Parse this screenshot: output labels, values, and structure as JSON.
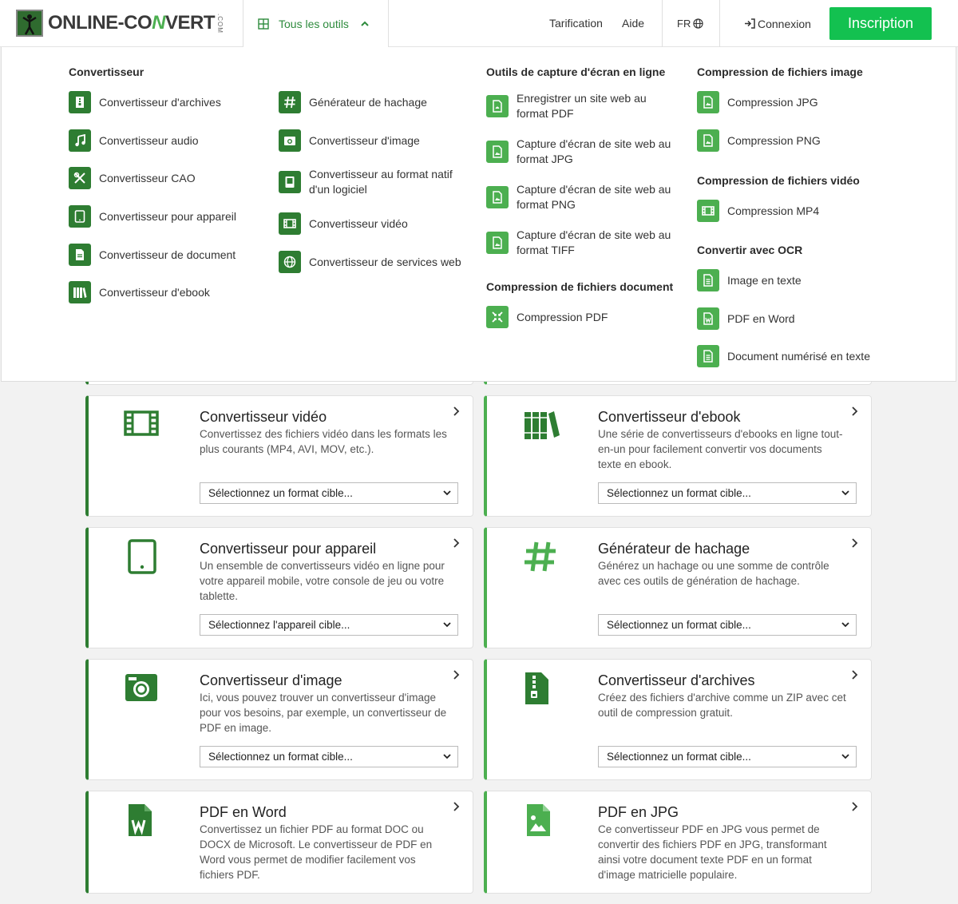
{
  "header": {
    "logo_prefix": "ONLINE-CO",
    "logo_accent": "N",
    "logo_suffix": "VERT",
    "logo_com": ".COM",
    "tools_label": "Tous les outils",
    "pricing": "Tarification",
    "help": "Aide",
    "lang": "FR",
    "login": "Connexion",
    "signup": "Inscription"
  },
  "dropdown": {
    "col1_title": "Convertisseur",
    "col1": [
      {
        "label": "Convertisseur d'archives",
        "icon": "archive-icon"
      },
      {
        "label": "Convertisseur audio",
        "icon": "music-note-icon"
      },
      {
        "label": "Convertisseur CAO",
        "icon": "cad-tools-icon"
      },
      {
        "label": "Convertisseur pour appareil",
        "icon": "tablet-icon"
      },
      {
        "label": "Convertisseur de document",
        "icon": "document-icon"
      },
      {
        "label": "Convertisseur d'ebook",
        "icon": "books-icon"
      }
    ],
    "col2": [
      {
        "label": "Générateur de hachage",
        "icon": "hash-icon"
      },
      {
        "label": "Convertisseur d'image",
        "icon": "camera-icon"
      },
      {
        "label": "Convertisseur au format natif d'un logiciel",
        "icon": "software-icon"
      },
      {
        "label": "Convertisseur vidéo",
        "icon": "film-icon"
      },
      {
        "label": "Convertisseur de services web",
        "icon": "globe-icon"
      }
    ],
    "col3_title": "Outils de capture d'écran en ligne",
    "col3": [
      {
        "label": "Enregistrer un site web au format PDF",
        "icon": "pdf-file-icon"
      },
      {
        "label": "Capture d'écran de site web au format JPG",
        "icon": "image-file-icon"
      },
      {
        "label": "Capture d'écran de site web au format PNG",
        "icon": "image-file-icon"
      },
      {
        "label": "Capture d'écran de site web au format TIFF",
        "icon": "image-file-icon"
      }
    ],
    "col3b_title": "Compression de fichiers document",
    "col3b": [
      {
        "label": "Compression PDF",
        "icon": "compress-icon"
      }
    ],
    "col4_title": "Compression de fichiers image",
    "col4": [
      {
        "label": "Compression JPG",
        "icon": "image-file-icon"
      },
      {
        "label": "Compression PNG",
        "icon": "image-file-icon"
      }
    ],
    "col4b_title": "Compression de fichiers vidéo",
    "col4b": [
      {
        "label": "Compression MP4",
        "icon": "film-icon"
      }
    ],
    "col4c_title": "Convertir avec OCR",
    "col4c": [
      {
        "label": "Image en texte",
        "icon": "text-file-icon"
      },
      {
        "label": "PDF en Word",
        "icon": "word-file-icon"
      },
      {
        "label": "Document numérisé en texte",
        "icon": "text-file-icon"
      }
    ]
  },
  "cards": [
    {
      "title": "Convertisseur vidéo",
      "desc": "Convertissez des fichiers vidéo dans les formats les plus courants (MP4, AVI, MOV, etc.).",
      "select": "Sélectionnez un format cible...",
      "icon": "film-icon"
    },
    {
      "title": "Convertisseur d'ebook",
      "desc": "Une série de convertisseurs d'ebooks en ligne tout-en-un pour facilement convertir vos documents texte en ebook.",
      "select": "Sélectionnez un format cible...",
      "icon": "books-icon"
    },
    {
      "title": "Convertisseur pour appareil",
      "desc": "Un ensemble de convertisseurs vidéo en ligne pour votre appareil mobile, votre console de jeu ou votre tablette.",
      "select": "Sélectionnez l'appareil cible...",
      "icon": "tablet-icon"
    },
    {
      "title": "Générateur de hachage",
      "desc": "Générez un hachage ou une somme de contrôle avec ces outils de génération de hachage.",
      "select": "Sélectionnez un format cible...",
      "icon": "hash-icon"
    },
    {
      "title": "Convertisseur d'image",
      "desc": "Ici, vous pouvez trouver un convertisseur d'image pour vos besoins, par exemple, un convertisseur de PDF en image.",
      "select": "Sélectionnez un format cible...",
      "icon": "camera-icon"
    },
    {
      "title": "Convertisseur d'archives",
      "desc": "Créez des fichiers d'archive comme un ZIP avec cet outil de compression gratuit.",
      "select": "Sélectionnez un format cible...",
      "icon": "archive-icon"
    },
    {
      "title": "PDF en Word",
      "desc": "Convertissez un fichier PDF au format DOC ou DOCX de Microsoft. Le convertisseur de PDF en Word vous permet de modifier facilement vos fichiers PDF.",
      "icon": "word-file-icon"
    },
    {
      "title": "PDF en JPG",
      "desc": "Ce convertisseur PDF en JPG vous permet de convertir des fichiers PDF en JPG, transformant ainsi votre document texte PDF en un format d'image matricielle populaire.",
      "icon": "image-file-icon"
    }
  ],
  "colors": {
    "brand_green": "#2e7d32",
    "light_green": "#4caf50",
    "signup_green": "#13c150"
  }
}
